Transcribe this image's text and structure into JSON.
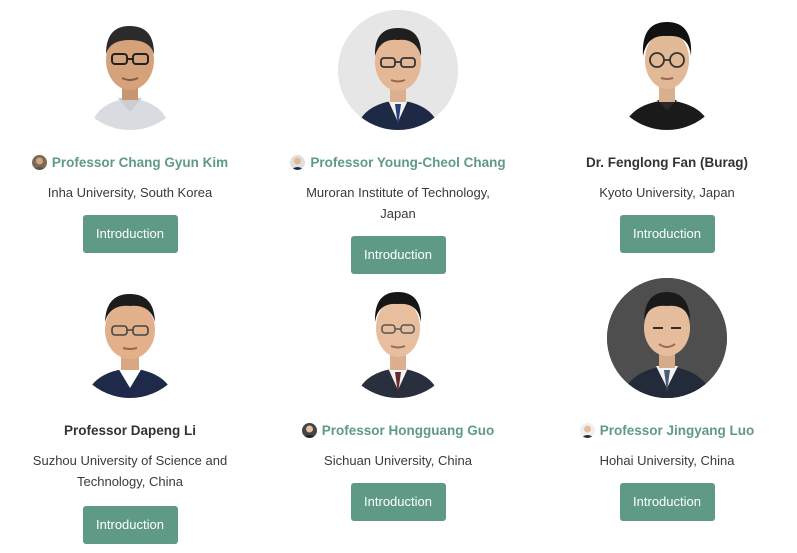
{
  "people": [
    {
      "name": "Professor Chang Gyun Kim",
      "affiliation": "Inha University, South Korea",
      "button": "Introduction"
    },
    {
      "name": "Professor Young-Cheol Chang",
      "affiliation": "Muroran Institute of Technology, Japan",
      "button": "Introduction"
    },
    {
      "name": "Dr. Fenglong Fan (Burag)",
      "affiliation": "Kyoto University, Japan",
      "button": "Introduction"
    },
    {
      "name": "Professor Dapeng Li",
      "affiliation": "Suzhou University of Science and Technology, China",
      "button": "Introduction"
    },
    {
      "name": "Professor Hongguang Guo",
      "affiliation": "Sichuan University, China",
      "button": "Introduction"
    },
    {
      "name": "Professor Jingyang Luo",
      "affiliation": "Hohai University, China",
      "button": "Introduction"
    }
  ],
  "colors": {
    "accent": "#5f9a87",
    "text": "#333333"
  }
}
